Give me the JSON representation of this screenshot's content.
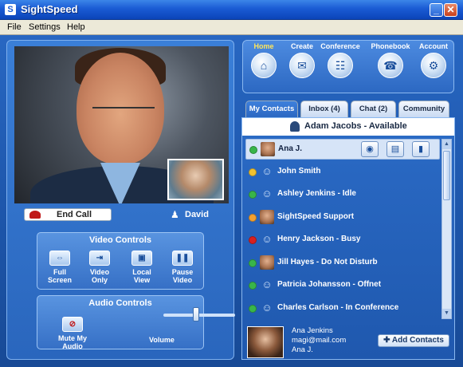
{
  "window": {
    "title": "SightSpeed",
    "minimize_glyph": "_",
    "close_glyph": "✕"
  },
  "menu": [
    "File",
    "Settings",
    "Help"
  ],
  "call": {
    "end_call_label": "End Call",
    "remote_name": "David"
  },
  "video_controls": {
    "title": "Video Controls",
    "buttons": [
      {
        "label": "Full Screen",
        "icon": "full-screen-icon"
      },
      {
        "label": "Video Only",
        "icon": "video-only-icon"
      },
      {
        "label": "Local View",
        "icon": "local-view-icon"
      },
      {
        "label": "Pause Video",
        "icon": "pause-video-icon"
      }
    ]
  },
  "audio_controls": {
    "title": "Audio Controls",
    "mute_label": "Mute My Audio",
    "volume_label": "Volume",
    "volume_level": 0.45
  },
  "nav": [
    {
      "label": "Home",
      "icon": "home-icon",
      "active": true
    },
    {
      "label": "Create",
      "icon": "create-icon",
      "active": false
    },
    {
      "label": "Conference",
      "icon": "conference-icon",
      "active": false
    },
    {
      "label": "Phonebook",
      "icon": "phonebook-icon",
      "active": false
    },
    {
      "label": "Account",
      "icon": "account-icon",
      "active": false
    }
  ],
  "tabs": [
    {
      "label": "My Contacts",
      "active": true
    },
    {
      "label": "Inbox (4)",
      "active": false
    },
    {
      "label": "Chat (2)",
      "active": false
    },
    {
      "label": "Community",
      "active": false
    }
  ],
  "me": {
    "status_line": "Adam Jacobs - Available"
  },
  "contacts": [
    {
      "name": "Ana J.",
      "status_color": "#39b54a",
      "avatar": true,
      "selected": true
    },
    {
      "name": "John Smith",
      "status_color": "#f2c230",
      "avatar": false,
      "selected": false
    },
    {
      "name": "Ashley Jenkins - Idle",
      "status_color": "#39b54a",
      "avatar": false,
      "selected": false
    },
    {
      "name": "SightSpeed Support",
      "status_color": "#f2a030",
      "avatar": true,
      "selected": false
    },
    {
      "name": "Henry Jackson - Busy",
      "status_color": "#d82020",
      "avatar": false,
      "selected": false
    },
    {
      "name": "Jill Hayes - Do Not Disturb",
      "status_color": "#39b54a",
      "avatar": true,
      "selected": false
    },
    {
      "name": "Patricia Johansson - Offnet",
      "status_color": "#39b54a",
      "avatar": false,
      "selected": false
    },
    {
      "name": "Charles Carlson - In Conference",
      "status_color": "#39b54a",
      "avatar": false,
      "selected": false
    }
  ],
  "selected_actions": [
    "video-call-icon",
    "contact-card-icon",
    "phonebook-book-icon"
  ],
  "profile": {
    "name": "Ana Jenkins",
    "email": "magi@mail.com",
    "alias": "Ana J."
  },
  "add_contacts_label": "Add Contacts"
}
